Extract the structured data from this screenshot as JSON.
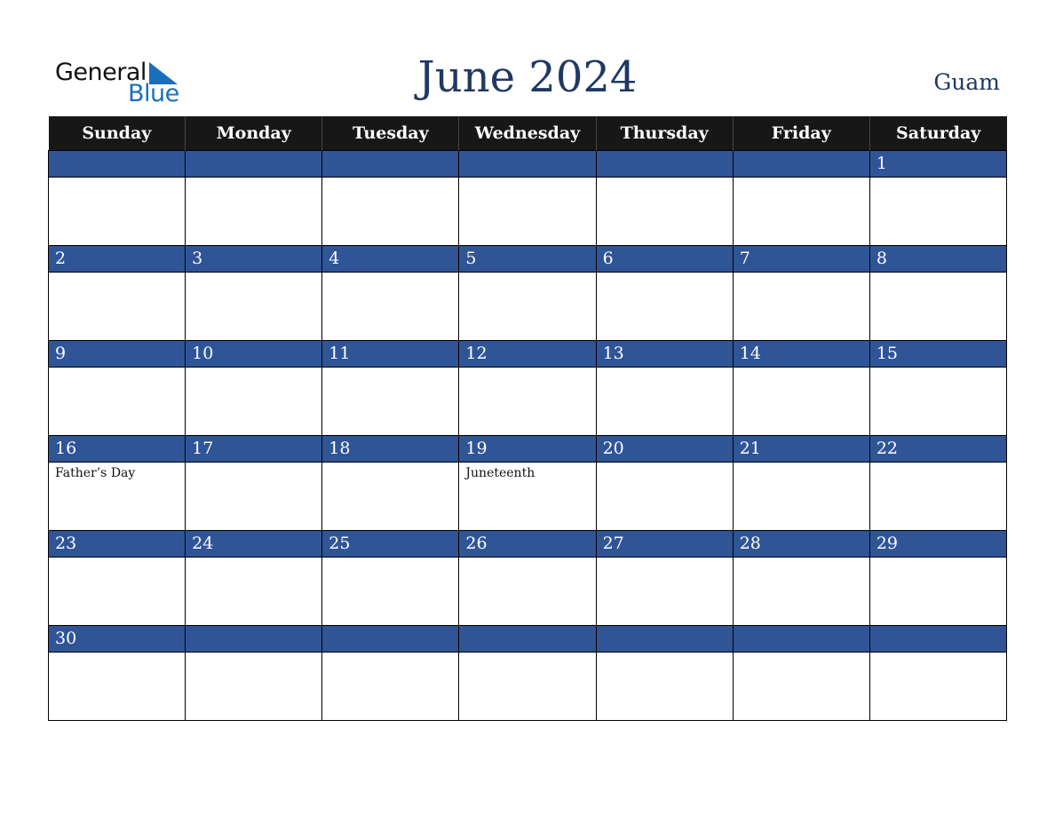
{
  "logo": {
    "line1": "General",
    "line2": "Blue"
  },
  "title": "June 2024",
  "region": "Guam",
  "colors": {
    "header_bg": "#171717",
    "band_bg": "#2f5597",
    "title": "#1f3864",
    "logo_blue": "#1a6fbd"
  },
  "weekdays": [
    "Sunday",
    "Monday",
    "Tuesday",
    "Wednesday",
    "Thursday",
    "Friday",
    "Saturday"
  ],
  "weeks": [
    [
      {
        "d": ""
      },
      {
        "d": ""
      },
      {
        "d": ""
      },
      {
        "d": ""
      },
      {
        "d": ""
      },
      {
        "d": ""
      },
      {
        "d": "1"
      }
    ],
    [
      {
        "d": "2"
      },
      {
        "d": "3"
      },
      {
        "d": "4"
      },
      {
        "d": "5"
      },
      {
        "d": "6"
      },
      {
        "d": "7"
      },
      {
        "d": "8"
      }
    ],
    [
      {
        "d": "9"
      },
      {
        "d": "10"
      },
      {
        "d": "11"
      },
      {
        "d": "12"
      },
      {
        "d": "13"
      },
      {
        "d": "14"
      },
      {
        "d": "15"
      }
    ],
    [
      {
        "d": "16",
        "e": "Father’s Day"
      },
      {
        "d": "17"
      },
      {
        "d": "18"
      },
      {
        "d": "19",
        "e": "Juneteenth"
      },
      {
        "d": "20"
      },
      {
        "d": "21"
      },
      {
        "d": "22"
      }
    ],
    [
      {
        "d": "23"
      },
      {
        "d": "24"
      },
      {
        "d": "25"
      },
      {
        "d": "26"
      },
      {
        "d": "27"
      },
      {
        "d": "28"
      },
      {
        "d": "29"
      }
    ],
    [
      {
        "d": "30"
      },
      {
        "d": ""
      },
      {
        "d": ""
      },
      {
        "d": ""
      },
      {
        "d": ""
      },
      {
        "d": ""
      },
      {
        "d": ""
      }
    ]
  ]
}
